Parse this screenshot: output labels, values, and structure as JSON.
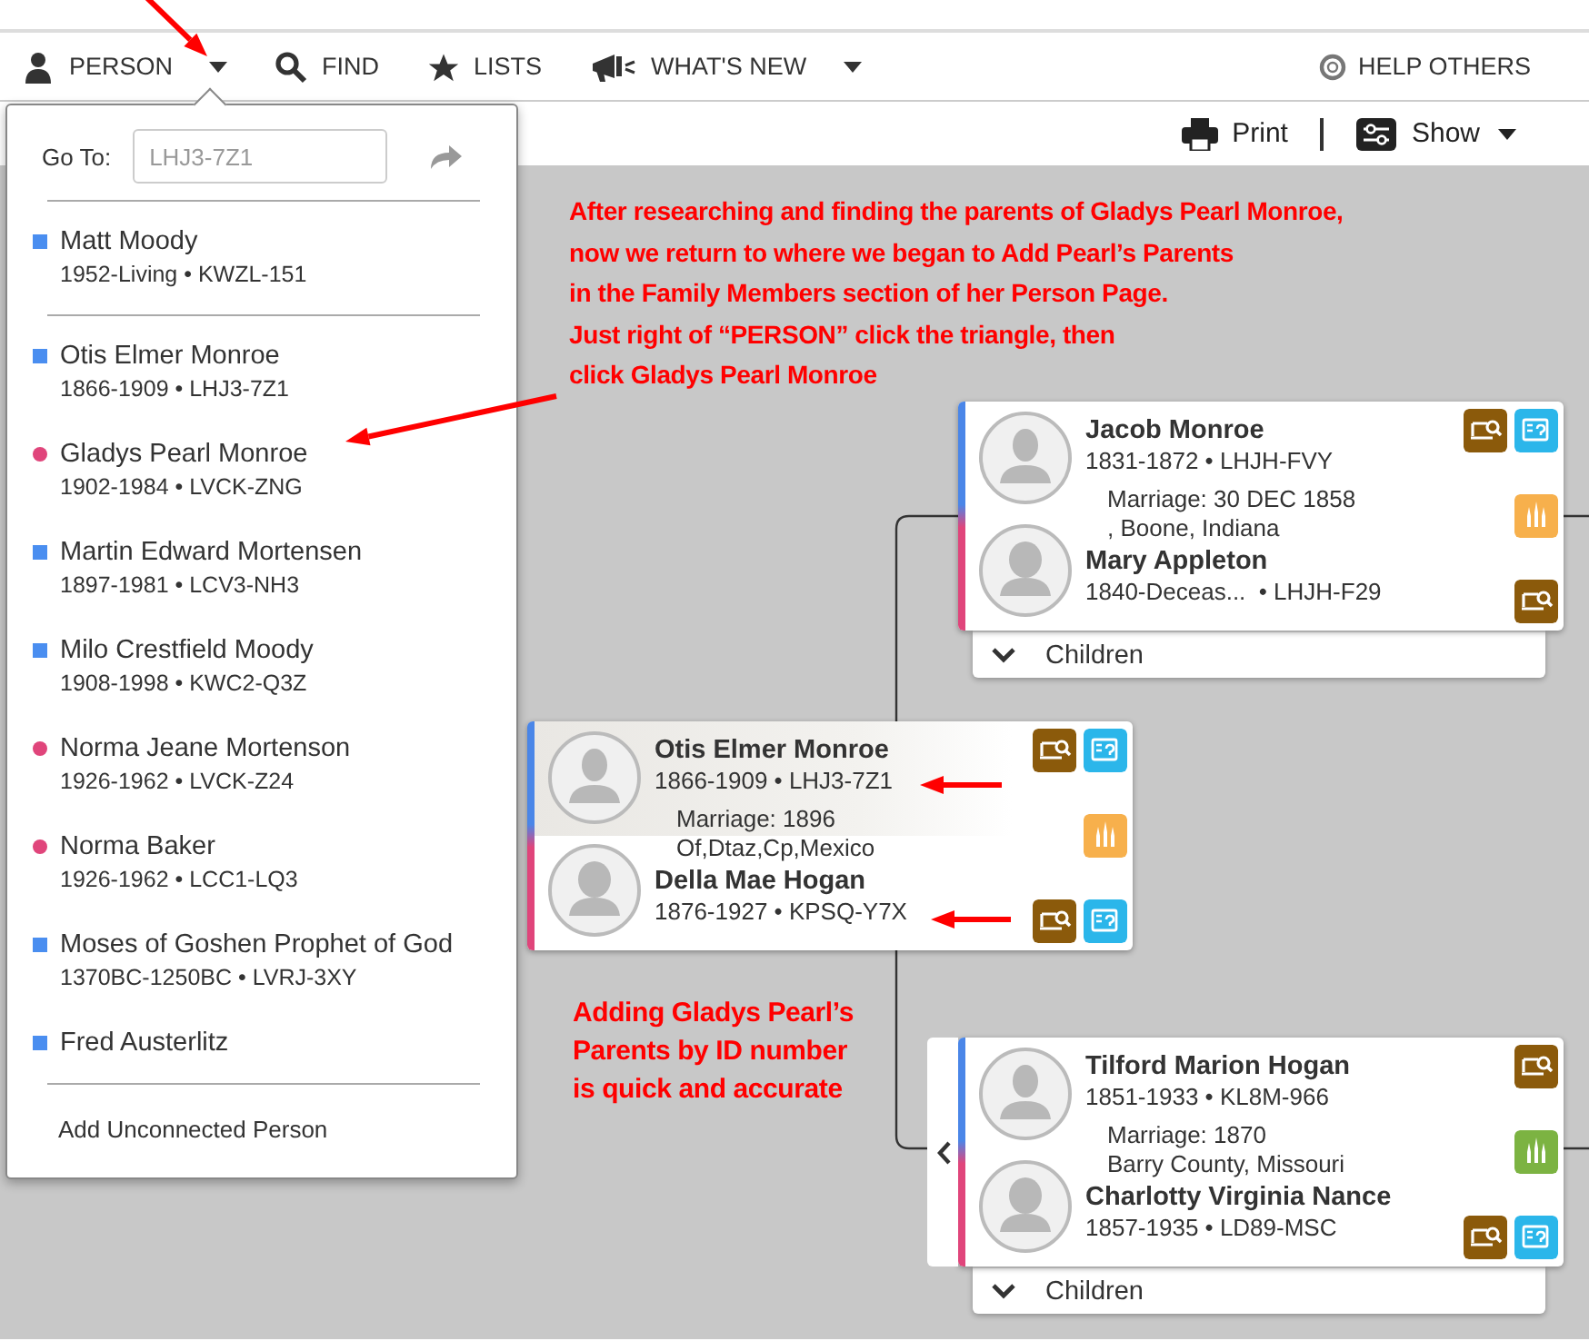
{
  "nav": {
    "items": [
      {
        "label": "PERSON",
        "caret": true
      },
      {
        "label": "FIND",
        "caret": false
      },
      {
        "label": "LISTS",
        "caret": false
      },
      {
        "label": "WHAT'S NEW",
        "caret": true
      }
    ],
    "help": "HELP OTHERS"
  },
  "toolbar": {
    "print": "Print",
    "show": "Show"
  },
  "person_menu": {
    "goto_label": "Go To:",
    "goto_placeholder": "LHJ3-7Z1",
    "groups": [
      [
        {
          "name": "Matt Moody",
          "details": "1952-Living • KWZL-151",
          "kind": "male"
        }
      ],
      [
        {
          "name": "Otis Elmer Monroe",
          "details": "1866-1909 • LHJ3-7Z1",
          "kind": "male"
        },
        {
          "name": "Gladys Pearl Monroe",
          "details": "1902-1984 • LVCK-ZNG",
          "kind": "female"
        },
        {
          "name": "Martin Edward Mortensen",
          "details": "1897-1981 • LCV3-NH3",
          "kind": "male"
        },
        {
          "name": "Milo Crestfield Moody",
          "details": "1908-1998 • KWC2-Q3Z",
          "kind": "male"
        },
        {
          "name": "Norma Jeane Mortenson",
          "details": "1926-1962 • LVCK-Z24",
          "kind": "female"
        },
        {
          "name": "Norma Baker",
          "details": "1926-1962 • LCC1-LQ3",
          "kind": "female"
        },
        {
          "name": "Moses of Goshen Prophet of God",
          "details": "1370BC-1250BC • LVRJ-3XY",
          "kind": "male"
        },
        {
          "name": "Fred Austerlitz",
          "kind": "male"
        }
      ]
    ],
    "add_label": "Add Unconnected Person"
  },
  "annotations": [
    {
      "text": "After researching and finding the parents of Gladys Pearl Monroe,\nnow we return to where we began to Add Pearl’s Parents\nin the Family Members section of her Person Page.\nJust right of “PERSON” click the triangle, then\nclick Gladys Pearl Monroe"
    },
    {
      "text": "Adding Gladys Pearl’s\nParents by ID number\nis quick and accurate"
    }
  ],
  "couples": [
    {
      "father": {
        "name": "Jacob Monroe",
        "details": "1831-1872 • LHJH-FVY",
        "record_hint": true,
        "research_hint": true,
        "selected": false
      },
      "marriage": [
        "Marriage: 30 DEC 1858",
        ", Boone, Indiana"
      ],
      "temple": {
        "color": "#f7b04c"
      },
      "mother": {
        "name": "Mary Appleton",
        "details": "1840-Deceas...  • LHJH-F29",
        "record_hint": true,
        "research_hint": false,
        "selected": false
      },
      "children_label": "Children",
      "expand_left": false
    },
    {
      "father": {
        "name": "Otis Elmer Monroe",
        "details": "1866-1909 • LHJ3-7Z1",
        "record_hint": true,
        "research_hint": true,
        "selected": true
      },
      "marriage": [
        "Marriage: 1896",
        "Of,Dtaz,Cp,Mexico"
      ],
      "temple": {
        "color": "#f7b04c"
      },
      "mother": {
        "name": "Della Mae Hogan",
        "details": "1876-1927 • KPSQ-Y7X",
        "record_hint": true,
        "research_hint": true,
        "selected": false
      },
      "expand_left": false
    },
    {
      "father": {
        "name": "Tilford Marion Hogan",
        "details": "1851-1933 • KL8M-966",
        "record_hint": true,
        "research_hint": false,
        "selected": false
      },
      "marriage": [
        "Marriage: 1870",
        "Barry County, Missouri"
      ],
      "temple": {
        "color": "#7cb342"
      },
      "mother": {
        "name": "Charlotty Virginia Nance",
        "details": "1857-1935 • LD89-MSC",
        "record_hint": true,
        "research_hint": true,
        "selected": false
      },
      "children_label": "Children",
      "expand_left": true
    }
  ]
}
